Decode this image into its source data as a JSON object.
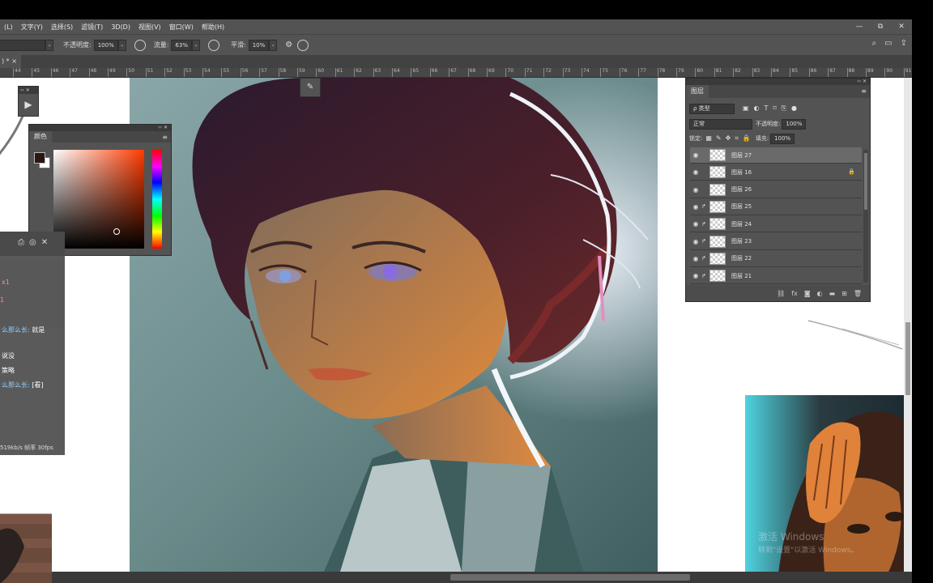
{
  "menu": {
    "items": [
      "(L)",
      "文字(Y)",
      "选择(S)",
      "滤镜(T)",
      "3D(D)",
      "视图(V)",
      "窗口(W)",
      "帮助(H)"
    ],
    "window_controls": [
      "—",
      "⧉",
      "✕"
    ]
  },
  "options": {
    "opacity_label": "不透明度:",
    "opacity_value": "100%",
    "flow_label": "流量:",
    "flow_value": "63%",
    "smooth_label": "平滑:",
    "smooth_value": "10%"
  },
  "doc_tab": {
    "label": ") * ×"
  },
  "ruler": {
    "ticks": [
      "44",
      "45",
      "46",
      "47",
      "48",
      "49",
      "50",
      "51",
      "52",
      "53",
      "54",
      "55",
      "56",
      "57",
      "58",
      "59",
      "60",
      "61",
      "62",
      "63",
      "64",
      "65",
      "66",
      "67",
      "68",
      "69",
      "70",
      "71",
      "72",
      "73",
      "74",
      "75",
      "76",
      "77",
      "78",
      "79",
      "80",
      "81",
      "82",
      "83",
      "84",
      "85",
      "86",
      "87",
      "88",
      "89",
      "90",
      "91"
    ]
  },
  "color_panel": {
    "title": "颜色",
    "foreground": "#2a1713",
    "background": "#ffffff"
  },
  "stream_overlay": {
    "messages": [
      {
        "text": "x1",
        "color": "#ff8b8b"
      },
      {
        "text": "1",
        "color": "#ff8b8b"
      }
    ],
    "chat_lines": [
      {
        "name": "么那么长:",
        "text": "就是"
      },
      {
        "name": "",
        "text": "说没"
      },
      {
        "name": "",
        "text": "策略"
      },
      {
        "name": "么那么长:",
        "text": "[看]"
      }
    ],
    "footer": "519kb/s  帧率 30fps"
  },
  "layers_panel": {
    "title": "图层",
    "filter_label": "ρ 类型",
    "blend_mode": "正常",
    "opacity_label": "不透明度:",
    "opacity_value": "100%",
    "lock_label": "锁定:",
    "fill_label": "填充:",
    "fill_value": "100%",
    "layers": [
      {
        "name": "图层 27",
        "selected": true,
        "clipped": false,
        "locked": false
      },
      {
        "name": "图层 16",
        "selected": false,
        "clipped": false,
        "locked": true
      },
      {
        "name": "图层 26",
        "selected": false,
        "clipped": false,
        "locked": false
      },
      {
        "name": "图层 25",
        "selected": false,
        "clipped": true,
        "locked": false
      },
      {
        "name": "图层 24",
        "selected": false,
        "clipped": true,
        "locked": false
      },
      {
        "name": "图层 23",
        "selected": false,
        "clipped": true,
        "locked": false
      },
      {
        "name": "图层 22",
        "selected": false,
        "clipped": true,
        "locked": false
      },
      {
        "name": "图层 21",
        "selected": false,
        "clipped": true,
        "locked": false
      }
    ]
  },
  "watermark": {
    "line1": "激活 Windows",
    "line2": "转到\"设置\"以激活 Windows。"
  }
}
